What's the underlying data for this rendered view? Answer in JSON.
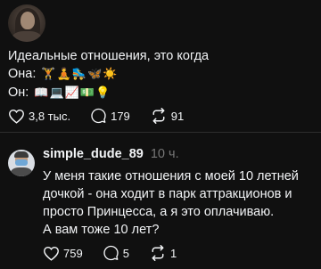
{
  "post": {
    "line1": "Идеальные отношения, это когда",
    "line2_label": "Она:",
    "line2_emoji": "🏋🧘🛼🦋☀️",
    "line3_label": "Он:",
    "line3_emoji": "📖💻📈💵💡",
    "likes": "3,8 тыс.",
    "replies": "179",
    "reposts": "91"
  },
  "comment": {
    "username": "simple_dude_89",
    "time": "10 ч.",
    "lines": [
      "У меня такие отношения с моей 10 летней",
      "дочкой - она ходит в парк аттракционов и",
      "просто Принцесса, а я это оплачиваю.",
      "А вам тоже 10 лет?"
    ],
    "likes": "759",
    "replies": "5",
    "reposts": "1"
  },
  "icons": {
    "like": "heart-icon",
    "reply": "comment-icon",
    "repost": "repost-icon"
  },
  "colors": {
    "background": "#101010",
    "text": "#f3f5f7",
    "muted": "#777777",
    "divider": "#2d2d2d"
  }
}
